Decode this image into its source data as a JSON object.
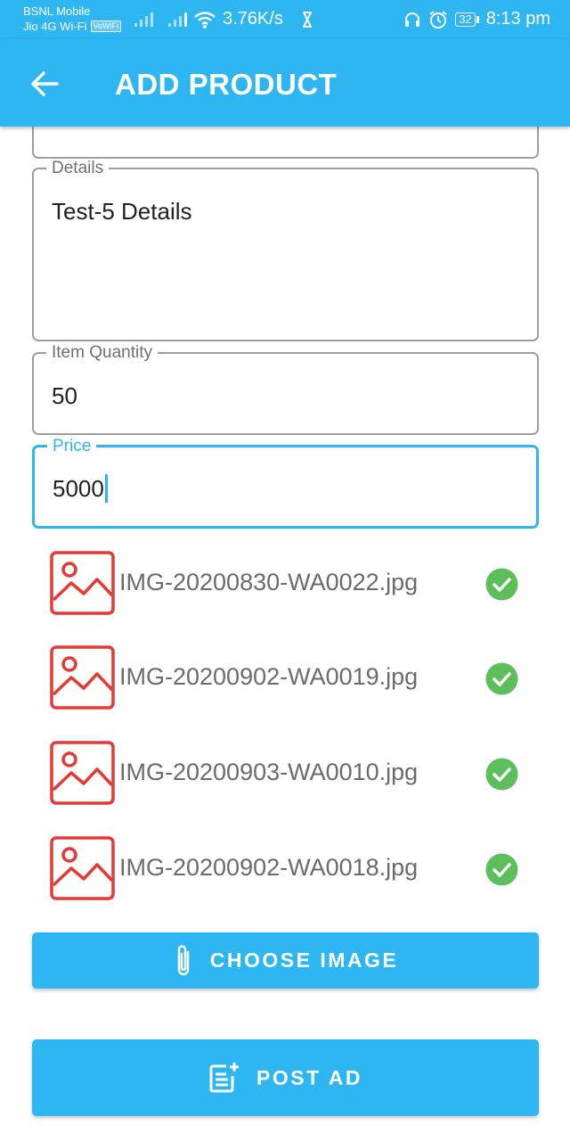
{
  "status_bar": {
    "carrier1": "BSNL Mobile",
    "carrier2": "Jio 4G Wi-Fi",
    "volte": "VoWiFi",
    "speed": "3.76K/s",
    "battery": "32",
    "time": "8:13 pm"
  },
  "app_bar": {
    "title": "ADD PRODUCT"
  },
  "form": {
    "details": {
      "label": "Details",
      "value": "Test-5 Details"
    },
    "quantity": {
      "label": "Item Quantity",
      "value": "50"
    },
    "price": {
      "label": "Price",
      "value": "5000"
    }
  },
  "images": [
    {
      "name": "IMG-20200830-WA0022.jpg",
      "status": "uploaded"
    },
    {
      "name": "IMG-20200902-WA0019.jpg",
      "status": "uploaded"
    },
    {
      "name": "IMG-20200903-WA0010.jpg",
      "status": "uploaded"
    },
    {
      "name": "IMG-20200902-WA0018.jpg",
      "status": "uploaded"
    }
  ],
  "buttons": {
    "choose_image": "CHOOSE IMAGE",
    "post_ad": "POST AD"
  },
  "colors": {
    "primary": "#2DB6F2",
    "image_icon": "#E53935",
    "check": "#5CBF5C"
  }
}
